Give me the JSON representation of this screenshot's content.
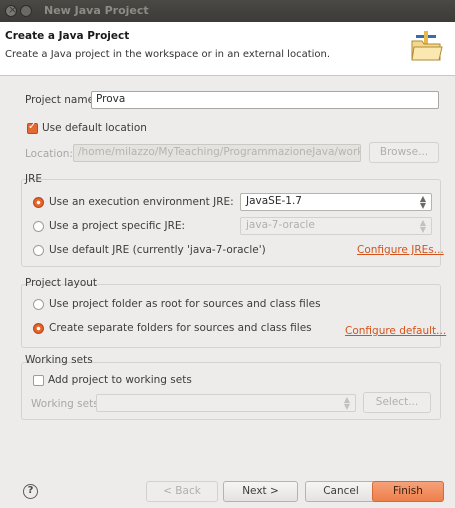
{
  "window": {
    "title": "New Java Project"
  },
  "banner": {
    "title": "Create a Java Project",
    "description": "Create a Java project in the workspace or in an external location.",
    "icon": "new-java-project-folder-icon"
  },
  "project": {
    "name_label": "Project name:",
    "name_value": "Prova",
    "use_default_location_label": "Use default location",
    "use_default_location_checked": true,
    "location_label": "Location:",
    "location_value": "/home/milazzo/MyTeaching/ProgrammazioneJava/workspace/",
    "browse_label": "Browse..."
  },
  "jre": {
    "title": "JRE",
    "options": [
      {
        "label": "Use an execution environment JRE:",
        "checked": true,
        "combo": "JavaSE-1.7"
      },
      {
        "label": "Use a project specific JRE:",
        "checked": false,
        "combo": "java-7-oracle"
      },
      {
        "label": "Use default JRE (currently 'java-7-oracle')",
        "checked": false
      }
    ],
    "configure_link": "Configure JREs..."
  },
  "layout": {
    "title": "Project layout",
    "options": [
      {
        "label": "Use project folder as root for sources and class files",
        "checked": false
      },
      {
        "label": "Create separate folders for sources and class files",
        "checked": true
      }
    ],
    "configure_link": "Configure default..."
  },
  "working_sets": {
    "title": "Working sets",
    "add_label": "Add project to working sets",
    "add_checked": false,
    "sets_label": "Working sets:",
    "sets_value": "",
    "select_label": "Select..."
  },
  "footer": {
    "help_glyph": "?",
    "back_label": "< Back",
    "next_label": "Next >",
    "cancel_label": "Cancel",
    "finish_label": "Finish"
  },
  "colors": {
    "accent": "#e8652a",
    "link": "#d4531c",
    "titlebar": "#3c3b37"
  }
}
